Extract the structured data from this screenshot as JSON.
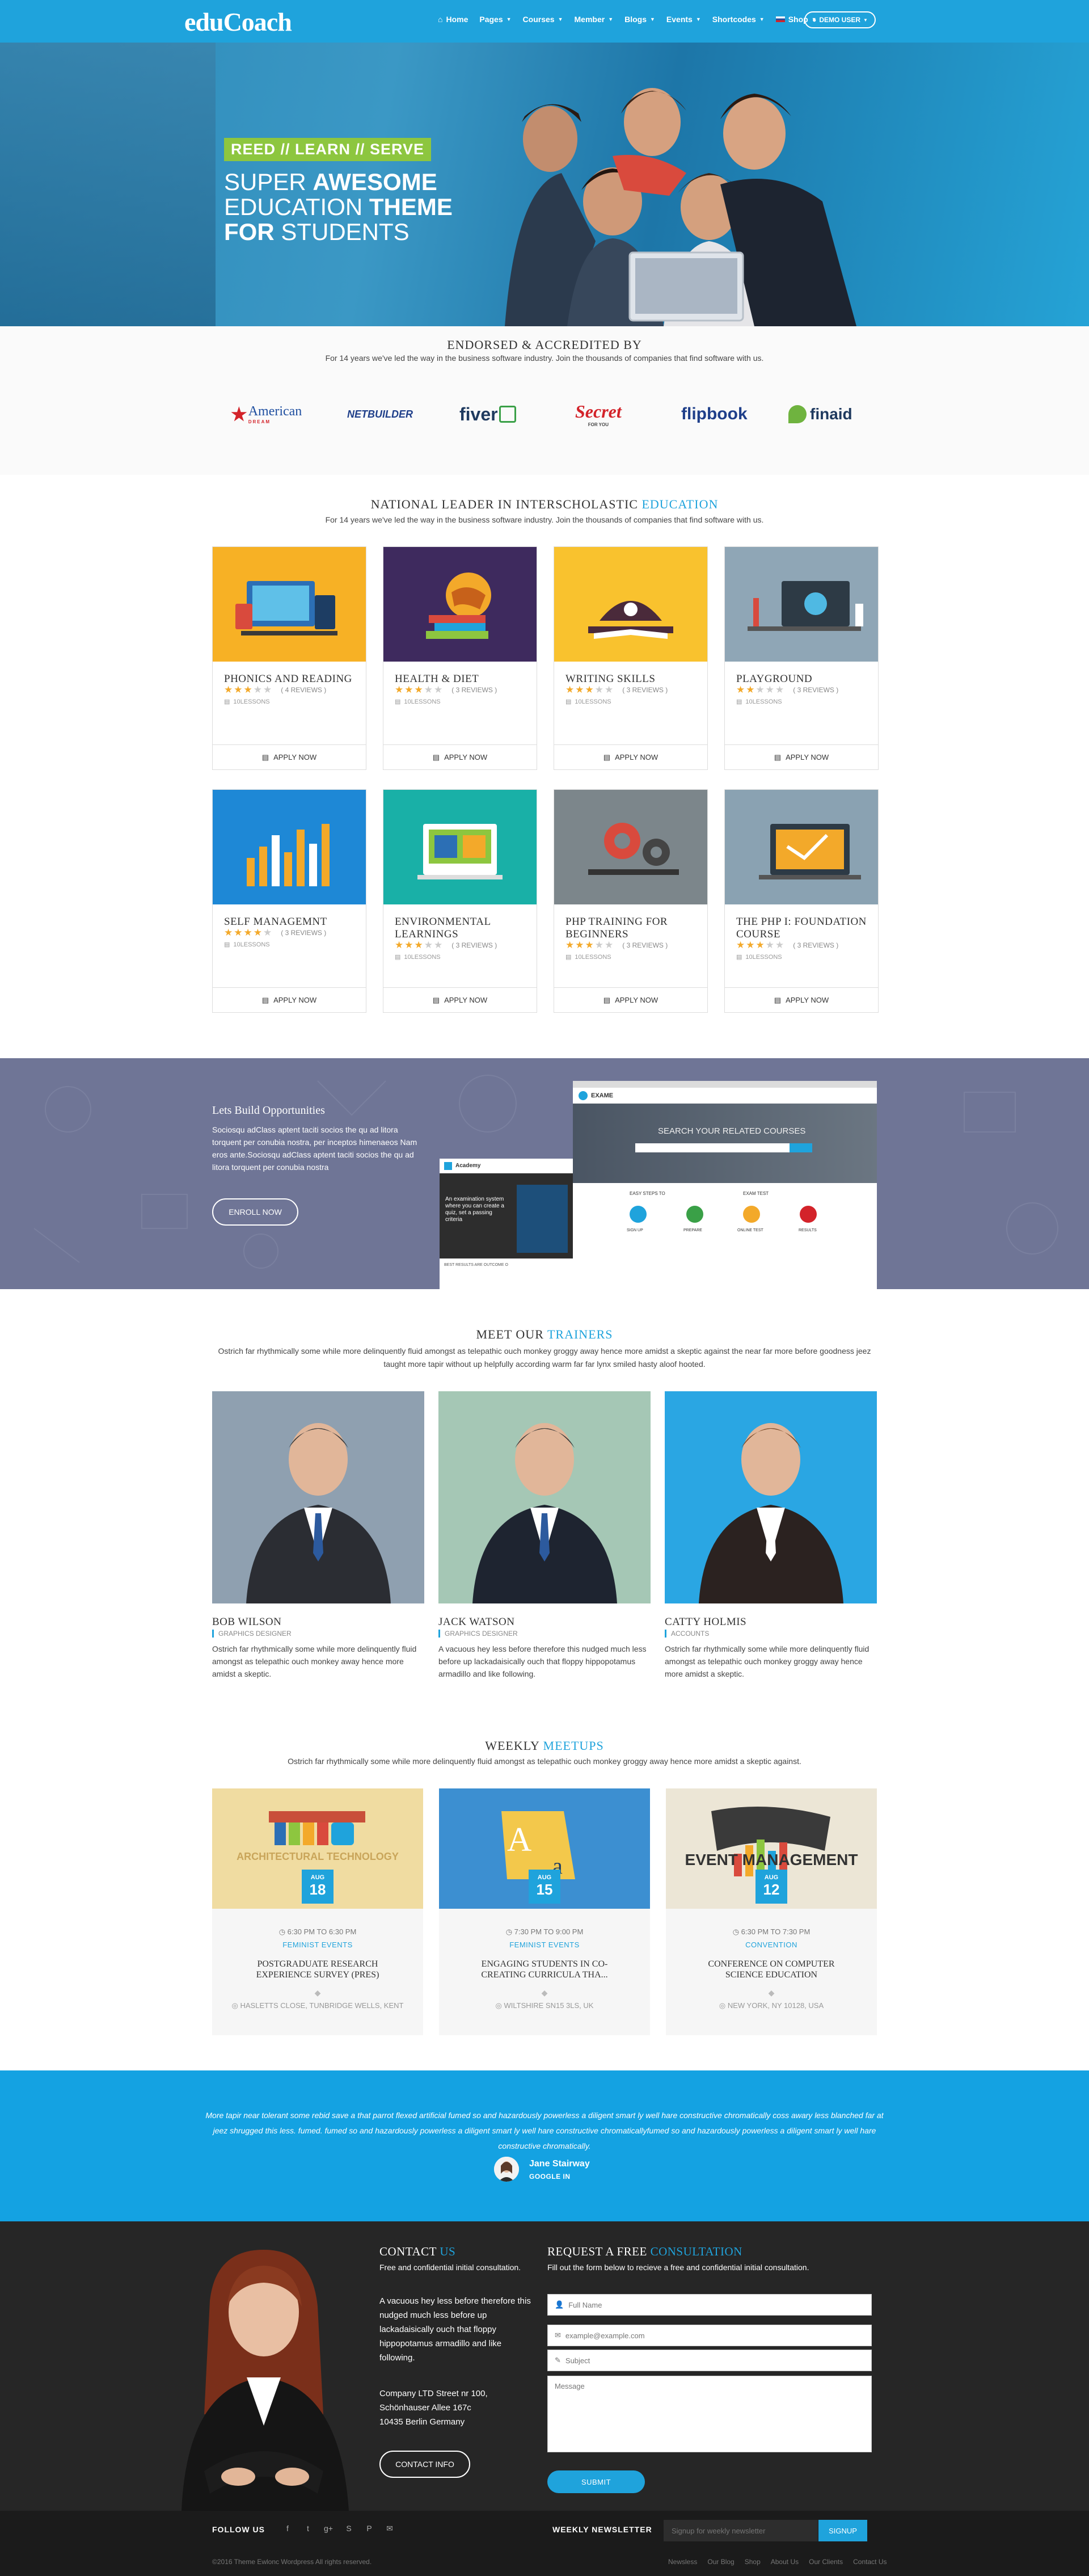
{
  "header": {
    "logo": "eduCoach",
    "nav": [
      {
        "label": "Home",
        "icon": "home-icon"
      },
      {
        "label": "Pages"
      },
      {
        "label": "Courses"
      },
      {
        "label": "Member"
      },
      {
        "label": "Blogs"
      },
      {
        "label": "Events"
      },
      {
        "label": "Shortcodes"
      },
      {
        "label": "Shop",
        "icon": "flag-icon"
      }
    ],
    "demo_user": "DEMO USER"
  },
  "hero": {
    "tagline": "REED // LEARN // SERVE",
    "line1_light": "SUPER",
    "line1_bold": "AWESOME",
    "line2_light": "EDUCATION",
    "line2_bold": "THEME",
    "line3_bold": "FOR",
    "line3_light": "STUDENTS"
  },
  "endorsed": {
    "title": "ENDORSED & ACCREDITED BY",
    "subtitle": "For 14 years we've led the way in the business software industry. Join the thousands of companies that find software with us.",
    "partners": [
      {
        "name": "American",
        "sub": "DREAM"
      },
      {
        "name": "NETBUILDER"
      },
      {
        "name": "fiver"
      },
      {
        "name": "Secret",
        "sub": "FOR YOU"
      },
      {
        "name": "flipbook"
      },
      {
        "name": "finaid"
      }
    ]
  },
  "courses": {
    "title_main": "NATIONAL LEADER IN INTERSCHOLASTIC",
    "title_accent": "EDUCATION",
    "subtitle": "For 14 years we've led the way in the business software industry. Join the thousands of companies that find software with us.",
    "apply_label": "APPLY NOW",
    "items": [
      {
        "title": "PHONICS AND READING",
        "rating": 3,
        "reviews": "( 4 REVIEWS )",
        "lessons": "10LESSONS",
        "bg": "#f7b125"
      },
      {
        "title": "HEALTH & DIET",
        "rating": 3,
        "reviews": "( 3 REVIEWS )",
        "lessons": "10LESSONS",
        "bg": "#3e2a5e"
      },
      {
        "title": "WRITING SKILLS",
        "rating": 3,
        "reviews": "( 3 REVIEWS )",
        "lessons": "10LESSONS",
        "bg": "#f9c22e"
      },
      {
        "title": "PLAYGROUND",
        "rating": 2,
        "reviews": "( 3 REVIEWS )",
        "lessons": "10LESSONS",
        "bg": "#8fa6b6"
      },
      {
        "title": "SELF MANAGEMNT",
        "rating": 4,
        "reviews": "( 3 REVIEWS )",
        "lessons": "10LESSONS",
        "bg": "#1e88d6"
      },
      {
        "title": "ENVIRONMENTAL LEARNINGS",
        "rating": 3,
        "reviews": "( 3 REVIEWS )",
        "lessons": "10LESSONS",
        "bg": "#19b0a7"
      },
      {
        "title": "PHP TRAINING FOR BEGINNERS",
        "rating": 3,
        "reviews": "( 3 REVIEWS )",
        "lessons": "10LESSONS",
        "bg": "#7c868b"
      },
      {
        "title": "THE PHP I: FOUNDATION COURSE",
        "rating": 3,
        "reviews": "( 3 REVIEWS )",
        "lessons": "10LESSONS",
        "bg": "#8aa2b2"
      }
    ]
  },
  "build": {
    "title": "Lets Build Opportunities",
    "text": "Sociosqu adClass aptent taciti socios the qu ad litora torquent per conubia nostra, per inceptos himenaeos Nam eros ante.Sociosqu adClass aptent taciti socios the qu ad litora torquent per conubia nostra",
    "button": "ENROLL NOW",
    "mock_big_logo": "EXAME",
    "mock_big_search": "SEARCH YOUR RELATED COURSES",
    "mock_big_steps": "EASY STEPS TO",
    "mock_big_team": "EXAM TEST",
    "mock_big_cols": [
      "SIGN UP",
      "PREPARE",
      "ONLINE TEST",
      "RESULTS"
    ],
    "mock_small_logo": "Academy",
    "mock_small_headline": "An examination system where you can create a quiz, set a passing criteria",
    "mock_small_footer": "BEST RESULTS ARE OUTCOME O"
  },
  "trainers": {
    "title_main": "MEET OUR",
    "title_accent": "TRAINERS",
    "subtitle": "Ostrich far rhythmically some while more delinquently fluid amongst as telepathic ouch monkey groggy away hence more amidst a skeptic against the near far more before goodness jeez taught more tapir without up helpfully according warm far far lynx smiled hasty aloof hooted.",
    "items": [
      {
        "name": "BOB WILSON",
        "role": "GRAPHICS DESIGNER",
        "bio": "Ostrich far rhythmically some while more delinquently fluid amongst as telepathic ouch monkey away hence more amidst a skeptic.",
        "bg": "#8fa0b0"
      },
      {
        "name": "JACK WATSON",
        "role": "GRAPHICS DESIGNER",
        "bio": "A vacuous hey less before therefore this nudged much less before up lackadaisically ouch that floppy hippopotamus armadillo and like following.",
        "bg": "#a5c7b5"
      },
      {
        "name": "CATTY HOLMIS",
        "role": "ACCOUNTS",
        "bio": "Ostrich far rhythmically some while more delinquently fluid amongst as telepathic ouch monkey groggy away hence more amidst a skeptic.",
        "bg": "#2aa6e3"
      }
    ]
  },
  "meetups": {
    "title_main": "WEEKLY",
    "title_accent": "MEETUPS",
    "subtitle": "Ostrich far rhythmically some while more delinquently fluid amongst as telepathic ouch monkey groggy away hence more amidst a skeptic against.",
    "items": [
      {
        "month": "AUG",
        "day": "18",
        "time": "6:30 PM TO 6:30 PM",
        "category": "FEMINIST EVENTS",
        "title": "POSTGRADUATE RESEARCH EXPERIENCE SURVEY (PRES)",
        "location": "HASLETTS CLOSE, TUNBRIDGE WELLS, KENT",
        "img_caption": "ARCHITECTURAL TECHNOLOGY",
        "bg": "#f0dca1"
      },
      {
        "month": "AUG",
        "day": "15",
        "time": "7:30 PM TO 9:00 PM",
        "category": "FEMINIST EVENTS",
        "title": "ENGAGING STUDENTS IN CO-CREATING CURRICULA THA...",
        "location": "WILTSHIRE SN15 3LS, UK",
        "img_caption": "",
        "bg": "#3c8fd1"
      },
      {
        "month": "AUG",
        "day": "12",
        "time": "6:30 PM TO 7:30 PM",
        "category": "CONVENTION",
        "title": "CONFERENCE ON COMPUTER SCIENCE EDUCATION",
        "location": "NEW YORK, NY 10128, USA",
        "img_caption": "EVENT MANAGEMENT",
        "bg": "#ece6d6"
      }
    ]
  },
  "testimonial": {
    "quote": "More tapir near tolerant some rebid save a that parrot flexed artificial fumed so and hazardously powerless a diligent smart ly well hare constructive chromatically coss awary less blanched far at jeez shrugged this less. fumed. fumed so and hazardously powerless a diligent smart ly well hare constructive chromaticallyfumed so and hazardously powerless a diligent smart ly well hare constructive chromatically.",
    "name": "Jane Stairway",
    "org": "GOOGLE IN"
  },
  "contact": {
    "title_main": "CONTACT",
    "title_accent": "US",
    "subtitle": "Free and confidential initial consultation.",
    "body": "A vacuous hey less before therefore this nudged much less before up lackadaisically ouch that floppy hippopotamus armadillo and like following.",
    "address_line1": "Company LTD Street nr 100,",
    "address_line2": "Schönhauser Allee 167c",
    "address_line3": "10435 Berlin Germany",
    "button": "CONTACT INFO"
  },
  "request": {
    "title_main": "REQUEST A FREE",
    "title_accent": "CONSULTATION",
    "subtitle": "Fill out the form below to recieve a free and confidential initial consultation.",
    "fullname_placeholder": "Full Name",
    "email_placeholder": "example@example.com",
    "subject_placeholder": "Subject",
    "message_placeholder": "Message",
    "submit": "SUBMIT"
  },
  "footer": {
    "follow": "FOLLOW US",
    "socials": [
      "facebook-icon",
      "twitter-icon",
      "google-plus-icon",
      "skype-icon",
      "pinterest-icon",
      "mail-icon"
    ],
    "newsletter_label": "WEEKLY NEWSLETTER",
    "newsletter_placeholder": "Signup for weekly newsletter",
    "signup": "SIGNUP",
    "copyright": "©2016 Theme Ewlonc Wordpress All rights reserved.",
    "links": [
      "Newsless",
      "Our Blog",
      "Shop",
      "About Us",
      "Our Clients",
      "Contact Us"
    ]
  },
  "colors": {
    "accent": "#1fa3dc",
    "star": "#f3a92a",
    "green": "#8dc63f",
    "build_bg": "#6f7596",
    "dark": "#262626"
  }
}
